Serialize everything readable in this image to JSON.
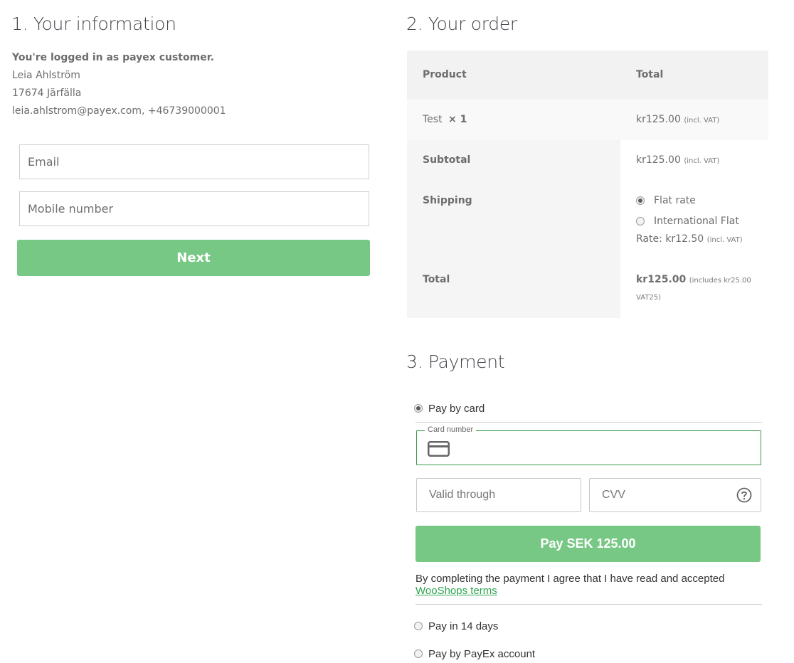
{
  "info": {
    "title": "1. Your information",
    "logged_in": "You're logged in as payex customer.",
    "name": "Leia Ahlström",
    "address": "17674 Järfälla",
    "contact": "leia.ahlstrom@payex.com, +46739000001",
    "email_placeholder": "Email",
    "mobile_placeholder": "Mobile number",
    "next_label": "Next"
  },
  "order": {
    "title": "2. Your order",
    "header_product": "Product",
    "header_total": "Total",
    "item_name": "Test",
    "item_qty": "× 1",
    "item_price": "kr125.00",
    "item_tax": "(incl. VAT)",
    "subtotal_label": "Subtotal",
    "subtotal_price": "kr125.00",
    "subtotal_tax": "(incl. VAT)",
    "shipping_label": "Shipping",
    "shipping_options": [
      {
        "label": "Flat rate",
        "selected": true
      },
      {
        "label": "International Flat",
        "selected": false
      }
    ],
    "shipping_rate_prefix": "Rate: kr12.50",
    "shipping_rate_tax": "(incl. VAT)",
    "total_label": "Total",
    "total_price": "kr125.00",
    "total_tax_line1": "(includes kr25.00",
    "total_tax_line2": "VAT25)"
  },
  "payment": {
    "title": "3. Payment",
    "methods": [
      {
        "label": "Pay by card",
        "selected": true
      },
      {
        "label": "Pay in 14 days",
        "selected": false
      },
      {
        "label": "Pay by PayEx account",
        "selected": false
      }
    ],
    "card_number_legend": "Card number",
    "card_number_value": "",
    "valid_through_placeholder": "Valid through",
    "cvv_placeholder": "CVV",
    "pay_label": "Pay SEK 125.00",
    "agree_text": "By completing the payment I agree that I have read and accepted",
    "terms_link": "WooShops terms"
  },
  "colors": {
    "accent_green": "#77c785",
    "field_focus_green": "#3a9a4a",
    "link_green": "#2ea44f"
  },
  "icons": {
    "card": "credit-card-icon",
    "cvv_help": "question-circle-icon"
  }
}
